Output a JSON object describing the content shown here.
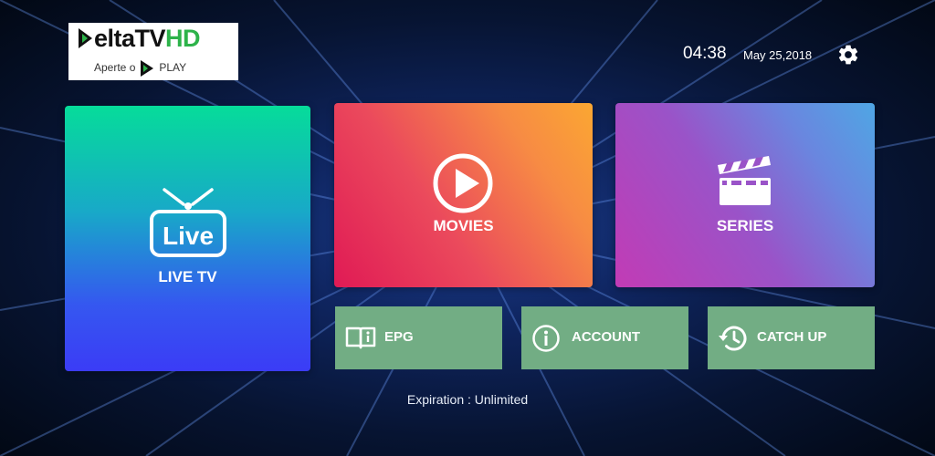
{
  "logo": {
    "brand_prefix": "elta",
    "brand_tv": "TV",
    "brand_hd": "HD",
    "tagline_before": "Aperte o",
    "tagline_after": "PLAY"
  },
  "header": {
    "time": "04:38",
    "date": "May 25,2018",
    "settings_icon": "gear-icon"
  },
  "tiles": {
    "live_tv": {
      "label": "LIVE TV",
      "icon": "live-tv-icon",
      "icon_text": "Live"
    },
    "movies": {
      "label": "MOVIES",
      "icon": "play-circle-icon"
    },
    "series": {
      "label": "SERIES",
      "icon": "clapperboard-icon"
    },
    "epg": {
      "label": "EPG",
      "icon": "book-info-icon"
    },
    "account": {
      "label": "ACCOUNT",
      "icon": "info-circle-icon"
    },
    "catch_up": {
      "label": "CATCH UP",
      "icon": "history-icon"
    }
  },
  "footer": {
    "expiration": "Expiration : Unlimited"
  },
  "colors": {
    "small_tile": "#72ad84",
    "logo_accent": "#2db34a"
  }
}
